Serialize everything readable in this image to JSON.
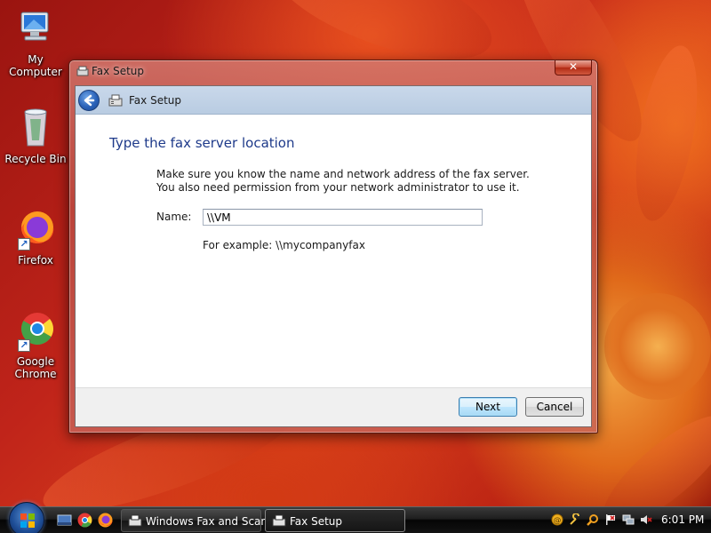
{
  "desktop": {
    "icons": [
      {
        "label": "My Computer",
        "icon": "computer-icon"
      },
      {
        "label": "Recycle Bin",
        "icon": "recycle-bin-icon"
      },
      {
        "label": "Firefox",
        "icon": "firefox-icon"
      },
      {
        "label": "Google Chrome",
        "icon": "chrome-icon"
      }
    ]
  },
  "window": {
    "title": "Fax Setup",
    "close_label": "✕",
    "nav_title": "Fax Setup",
    "heading": "Type the fax server location",
    "description_line1": "Make sure you know the name and network address of the fax server.",
    "description_line2": "You also need permission from your network administrator to use it.",
    "name_label": "Name:",
    "name_value": "\\\\VM",
    "example": "For example: \\\\mycompanyfax",
    "next_label": "Next",
    "cancel_label": "Cancel"
  },
  "taskbar": {
    "quick_launch": [
      "show-desktop-icon",
      "chrome-icon",
      "firefox-icon"
    ],
    "tasks": [
      {
        "label": "Windows Fax and Scan",
        "icon": "fax-icon"
      },
      {
        "label": "Fax Setup",
        "icon": "fax-icon",
        "active": true
      }
    ],
    "tray_icons": [
      "security-icon",
      "tools-icon",
      "search-icon",
      "flag-icon",
      "network-icon",
      "volume-icon"
    ],
    "clock": "6:01 PM"
  },
  "colors": {
    "heading": "#1e3a8a",
    "nav_header": "#c9d8ea",
    "default_button_border": "#3c7fb1"
  }
}
